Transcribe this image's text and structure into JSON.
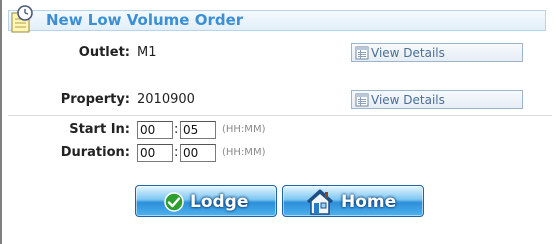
{
  "form": {
    "title": "New Low Volume Order",
    "outlet": {
      "label": "Outlet:",
      "value": "M1",
      "details_label": "View Details"
    },
    "property": {
      "label": "Property:",
      "value": "2010900",
      "details_label": "View Details"
    },
    "start_in": {
      "label": "Start In:",
      "hours": "00",
      "minutes": "05",
      "hint": "(HH:MM)"
    },
    "duration": {
      "label": "Duration:",
      "hours": "00",
      "minutes": "00",
      "hint": "(HH:MM)"
    },
    "separator": ":"
  },
  "actions": {
    "lodge_label": "Lodge",
    "home_label": "Home"
  },
  "colors": {
    "title": "#3a8fd6",
    "button_blue": "#2d8fd8",
    "lodge_check": "#2e9e2e"
  },
  "icons": [
    "notepad-clock-icon",
    "document-icon",
    "checkmark-icon",
    "house-icon"
  ]
}
